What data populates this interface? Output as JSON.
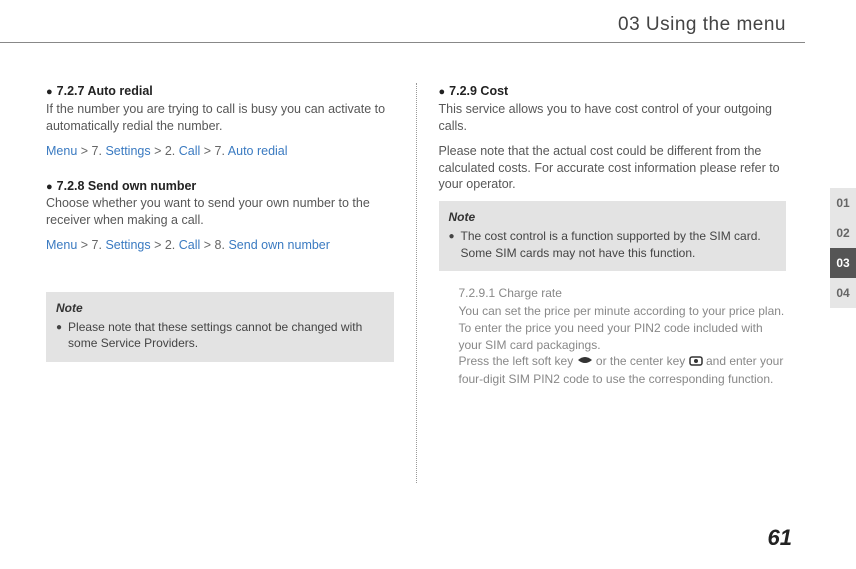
{
  "header": {
    "chapter": "03 Using the menu"
  },
  "left": {
    "s1": {
      "title": "7.2.7  Auto redial",
      "body": "If the number you are trying to call is busy you can activate to automatically redial the number.",
      "crumb": {
        "p1": "Menu",
        "p2": " > 7. ",
        "p3": "Settings",
        "p4": " > 2. ",
        "p5": "Call",
        "p6": " > 7. ",
        "p7": "Auto redial"
      }
    },
    "s2": {
      "title": "7.2.8  Send own number",
      "body": "Choose whether you want to send your own number to the receiver when making a call.",
      "crumb": {
        "p1": "Menu",
        "p2": " > 7. ",
        "p3": "Settings",
        "p4": " > 2. ",
        "p5": "Call",
        "p6": " > 8. ",
        "p7": "Send own number"
      }
    },
    "note": {
      "hdr": "Note",
      "item": "Please note that these settings cannot be changed with some Service Providers."
    }
  },
  "right": {
    "s1": {
      "title": "7.2.9  Cost",
      "body1": "This service allows you to have cost control of your outgoing calls.",
      "body2": "Please note that the actual cost could be different from the calculated costs. For accurate cost information please refer to your operator."
    },
    "note": {
      "hdr": "Note",
      "item": "The cost control is a function supported by the SIM card. Some SIM cards may not have this function."
    },
    "sub": {
      "title": "7.2.9.1  Charge rate",
      "body1": "You can set the price per minute according to your price plan. To enter the price you need your PIN2 code included with your SIM card packagings.",
      "body2a": "Press the left soft key ",
      "body2b": " or the center key ",
      "body2c": " and enter your four-digit SIM PIN2 code to use the corresponding function."
    }
  },
  "tabs": {
    "t1": "01",
    "t2": "02",
    "t3": "03",
    "t4": "04"
  },
  "page": "61"
}
